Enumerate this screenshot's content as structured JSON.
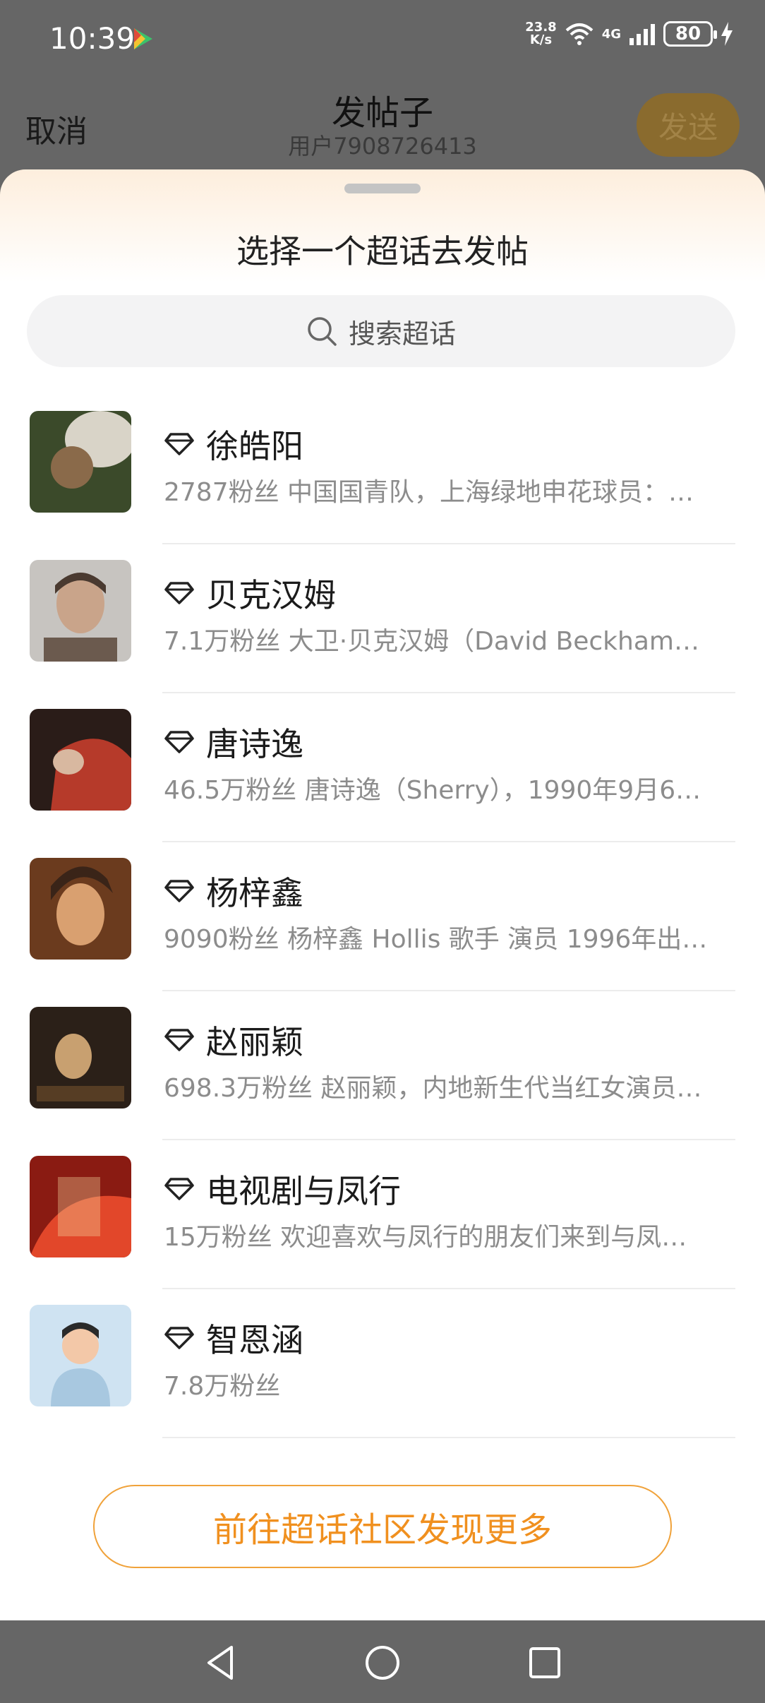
{
  "status_bar": {
    "time": "10:39",
    "speed_value": "23.8",
    "speed_unit": "K/s",
    "signal_label": "4G",
    "battery": "80"
  },
  "header": {
    "cancel_label": "取消",
    "title": "发帖子",
    "subtitle": "用户7908726413",
    "send_label": "发送"
  },
  "sheet": {
    "title": "选择一个超话去发帖",
    "search_placeholder": "搜索超话",
    "items": [
      {
        "name": "徐皓阳",
        "desc": "2787粉丝 中国国青队，上海绿地申花球员：…",
        "avatar_colors": [
          "#3b4a2a",
          "#d9d4c8"
        ]
      },
      {
        "name": "贝克汉姆",
        "desc": "7.1万粉丝 大卫·贝克汉姆（David Beckham…",
        "avatar_colors": [
          "#c7c4c0",
          "#6b5a4e"
        ]
      },
      {
        "name": "唐诗逸",
        "desc": "46.5万粉丝 唐诗逸（Sherry），1990年9月6…",
        "avatar_colors": [
          "#2a1c18",
          "#b63a2a"
        ]
      },
      {
        "name": "杨梓鑫",
        "desc": "9090粉丝 杨梓鑫 Hollis 歌手 演员  1996年出…",
        "avatar_colors": [
          "#6b3b1e",
          "#d9a070"
        ]
      },
      {
        "name": "赵丽颖",
        "desc": "698.3万粉丝 赵丽颖，内地新生代当红女演员…",
        "avatar_colors": [
          "#2b2018",
          "#c8a070"
        ]
      },
      {
        "name": "电视剧与凤行",
        "desc": "15万粉丝 欢迎喜欢与凤行的朋友们来到与凤…",
        "avatar_colors": [
          "#8a1b12",
          "#e2472a"
        ]
      },
      {
        "name": "智恩涵",
        "desc": "7.8万粉丝",
        "avatar_colors": [
          "#cfe3f2",
          "#f3c8a8"
        ]
      }
    ],
    "explore_label": "前往超话社区发现更多"
  },
  "colors": {
    "accent": "#f0901f",
    "overlay": "#666666"
  }
}
